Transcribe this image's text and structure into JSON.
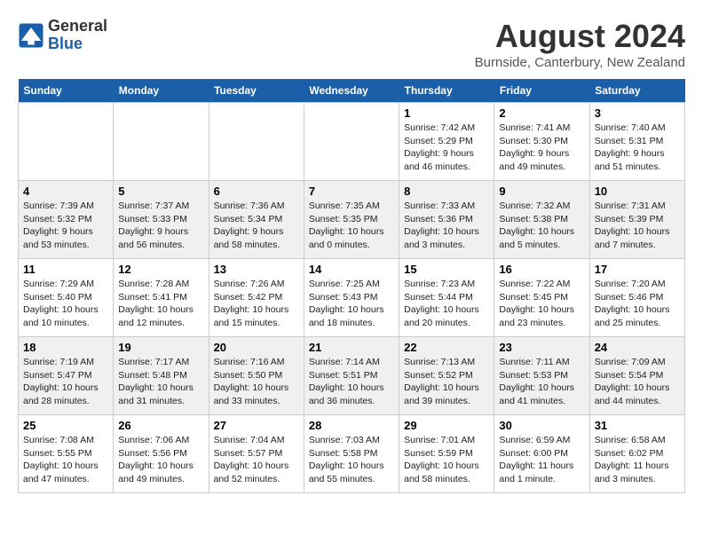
{
  "header": {
    "logo_general": "General",
    "logo_blue": "Blue",
    "month_title": "August 2024",
    "location": "Burnside, Canterbury, New Zealand"
  },
  "weekdays": [
    "Sunday",
    "Monday",
    "Tuesday",
    "Wednesday",
    "Thursday",
    "Friday",
    "Saturday"
  ],
  "weeks": [
    [
      {
        "day": "",
        "info": ""
      },
      {
        "day": "",
        "info": ""
      },
      {
        "day": "",
        "info": ""
      },
      {
        "day": "",
        "info": ""
      },
      {
        "day": "1",
        "info": "Sunrise: 7:42 AM\nSunset: 5:29 PM\nDaylight: 9 hours\nand 46 minutes."
      },
      {
        "day": "2",
        "info": "Sunrise: 7:41 AM\nSunset: 5:30 PM\nDaylight: 9 hours\nand 49 minutes."
      },
      {
        "day": "3",
        "info": "Sunrise: 7:40 AM\nSunset: 5:31 PM\nDaylight: 9 hours\nand 51 minutes."
      }
    ],
    [
      {
        "day": "4",
        "info": "Sunrise: 7:39 AM\nSunset: 5:32 PM\nDaylight: 9 hours\nand 53 minutes."
      },
      {
        "day": "5",
        "info": "Sunrise: 7:37 AM\nSunset: 5:33 PM\nDaylight: 9 hours\nand 56 minutes."
      },
      {
        "day": "6",
        "info": "Sunrise: 7:36 AM\nSunset: 5:34 PM\nDaylight: 9 hours\nand 58 minutes."
      },
      {
        "day": "7",
        "info": "Sunrise: 7:35 AM\nSunset: 5:35 PM\nDaylight: 10 hours\nand 0 minutes."
      },
      {
        "day": "8",
        "info": "Sunrise: 7:33 AM\nSunset: 5:36 PM\nDaylight: 10 hours\nand 3 minutes."
      },
      {
        "day": "9",
        "info": "Sunrise: 7:32 AM\nSunset: 5:38 PM\nDaylight: 10 hours\nand 5 minutes."
      },
      {
        "day": "10",
        "info": "Sunrise: 7:31 AM\nSunset: 5:39 PM\nDaylight: 10 hours\nand 7 minutes."
      }
    ],
    [
      {
        "day": "11",
        "info": "Sunrise: 7:29 AM\nSunset: 5:40 PM\nDaylight: 10 hours\nand 10 minutes."
      },
      {
        "day": "12",
        "info": "Sunrise: 7:28 AM\nSunset: 5:41 PM\nDaylight: 10 hours\nand 12 minutes."
      },
      {
        "day": "13",
        "info": "Sunrise: 7:26 AM\nSunset: 5:42 PM\nDaylight: 10 hours\nand 15 minutes."
      },
      {
        "day": "14",
        "info": "Sunrise: 7:25 AM\nSunset: 5:43 PM\nDaylight: 10 hours\nand 18 minutes."
      },
      {
        "day": "15",
        "info": "Sunrise: 7:23 AM\nSunset: 5:44 PM\nDaylight: 10 hours\nand 20 minutes."
      },
      {
        "day": "16",
        "info": "Sunrise: 7:22 AM\nSunset: 5:45 PM\nDaylight: 10 hours\nand 23 minutes."
      },
      {
        "day": "17",
        "info": "Sunrise: 7:20 AM\nSunset: 5:46 PM\nDaylight: 10 hours\nand 25 minutes."
      }
    ],
    [
      {
        "day": "18",
        "info": "Sunrise: 7:19 AM\nSunset: 5:47 PM\nDaylight: 10 hours\nand 28 minutes."
      },
      {
        "day": "19",
        "info": "Sunrise: 7:17 AM\nSunset: 5:48 PM\nDaylight: 10 hours\nand 31 minutes."
      },
      {
        "day": "20",
        "info": "Sunrise: 7:16 AM\nSunset: 5:50 PM\nDaylight: 10 hours\nand 33 minutes."
      },
      {
        "day": "21",
        "info": "Sunrise: 7:14 AM\nSunset: 5:51 PM\nDaylight: 10 hours\nand 36 minutes."
      },
      {
        "day": "22",
        "info": "Sunrise: 7:13 AM\nSunset: 5:52 PM\nDaylight: 10 hours\nand 39 minutes."
      },
      {
        "day": "23",
        "info": "Sunrise: 7:11 AM\nSunset: 5:53 PM\nDaylight: 10 hours\nand 41 minutes."
      },
      {
        "day": "24",
        "info": "Sunrise: 7:09 AM\nSunset: 5:54 PM\nDaylight: 10 hours\nand 44 minutes."
      }
    ],
    [
      {
        "day": "25",
        "info": "Sunrise: 7:08 AM\nSunset: 5:55 PM\nDaylight: 10 hours\nand 47 minutes."
      },
      {
        "day": "26",
        "info": "Sunrise: 7:06 AM\nSunset: 5:56 PM\nDaylight: 10 hours\nand 49 minutes."
      },
      {
        "day": "27",
        "info": "Sunrise: 7:04 AM\nSunset: 5:57 PM\nDaylight: 10 hours\nand 52 minutes."
      },
      {
        "day": "28",
        "info": "Sunrise: 7:03 AM\nSunset: 5:58 PM\nDaylight: 10 hours\nand 55 minutes."
      },
      {
        "day": "29",
        "info": "Sunrise: 7:01 AM\nSunset: 5:59 PM\nDaylight: 10 hours\nand 58 minutes."
      },
      {
        "day": "30",
        "info": "Sunrise: 6:59 AM\nSunset: 6:00 PM\nDaylight: 11 hours\nand 1 minute."
      },
      {
        "day": "31",
        "info": "Sunrise: 6:58 AM\nSunset: 6:02 PM\nDaylight: 11 hours\nand 3 minutes."
      }
    ]
  ]
}
